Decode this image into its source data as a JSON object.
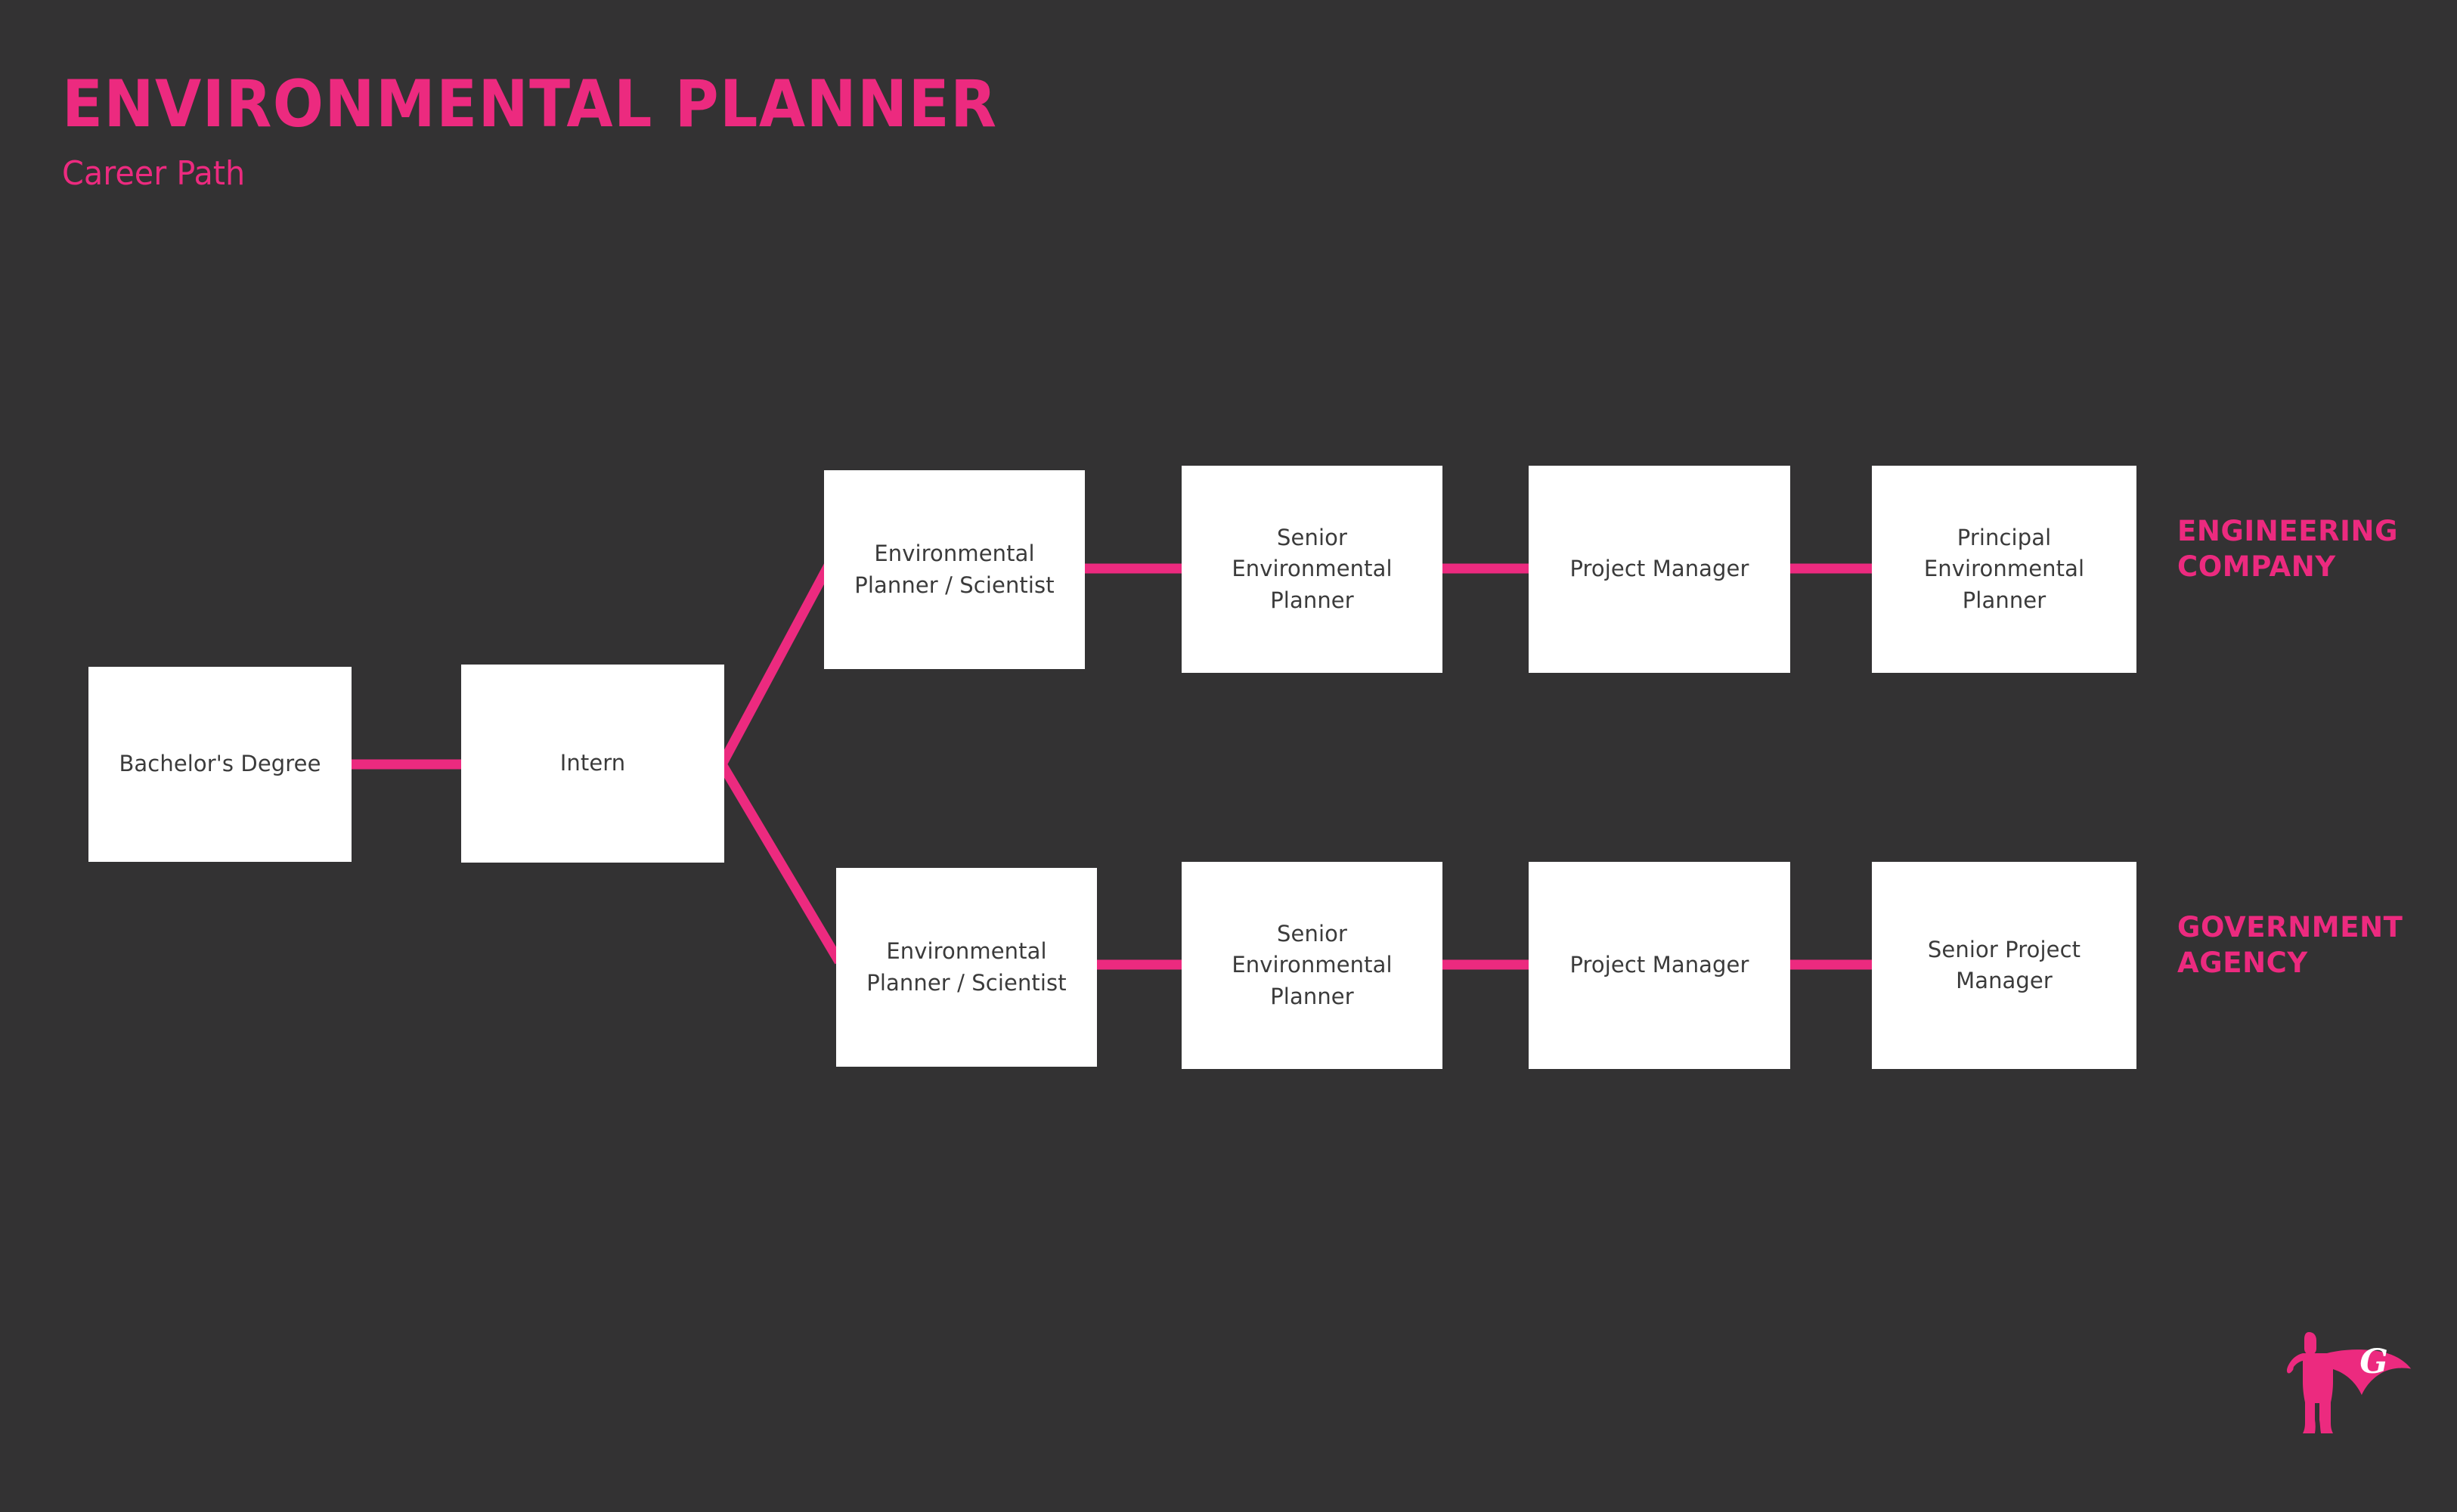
{
  "header": {
    "title": "ENVIRONMENTAL PLANNER",
    "subtitle": "Career Path"
  },
  "colors": {
    "background": "#333233",
    "accent_pink": "#ec2a7f",
    "node_fill": "#ffffff",
    "node_text": "#3b3b3b"
  },
  "diagram": {
    "type": "flowchart",
    "orientation": "left-to-right",
    "shared_nodes": [
      {
        "id": "bachelors",
        "label": "Bachelor's Degree"
      },
      {
        "id": "intern",
        "label": "Intern"
      }
    ],
    "branches": [
      {
        "id": "engineering-company",
        "track_label": "ENGINEERING\nCOMPANY",
        "nodes": [
          {
            "id": "eng-eps",
            "label": "Environmental\nPlanner / Scientist"
          },
          {
            "id": "eng-sep",
            "label": "Senior\nEnvironmental\nPlanner"
          },
          {
            "id": "eng-pm",
            "label": "Project Manager"
          },
          {
            "id": "eng-pep",
            "label": "Principal\nEnvironmental\nPlanner"
          }
        ]
      },
      {
        "id": "government-agency",
        "track_label": "GOVERNMENT\nAGENCY",
        "nodes": [
          {
            "id": "gov-eps",
            "label": "Environmental\nPlanner / Scientist"
          },
          {
            "id": "gov-sep",
            "label": "Senior\nEnvironmental\nPlanner"
          },
          {
            "id": "gov-pm",
            "label": "Project Manager"
          },
          {
            "id": "gov-spm",
            "label": "Senior Project\nManager"
          }
        ]
      }
    ]
  },
  "logo": {
    "name": "superhero-g-logo",
    "letter": "G"
  }
}
